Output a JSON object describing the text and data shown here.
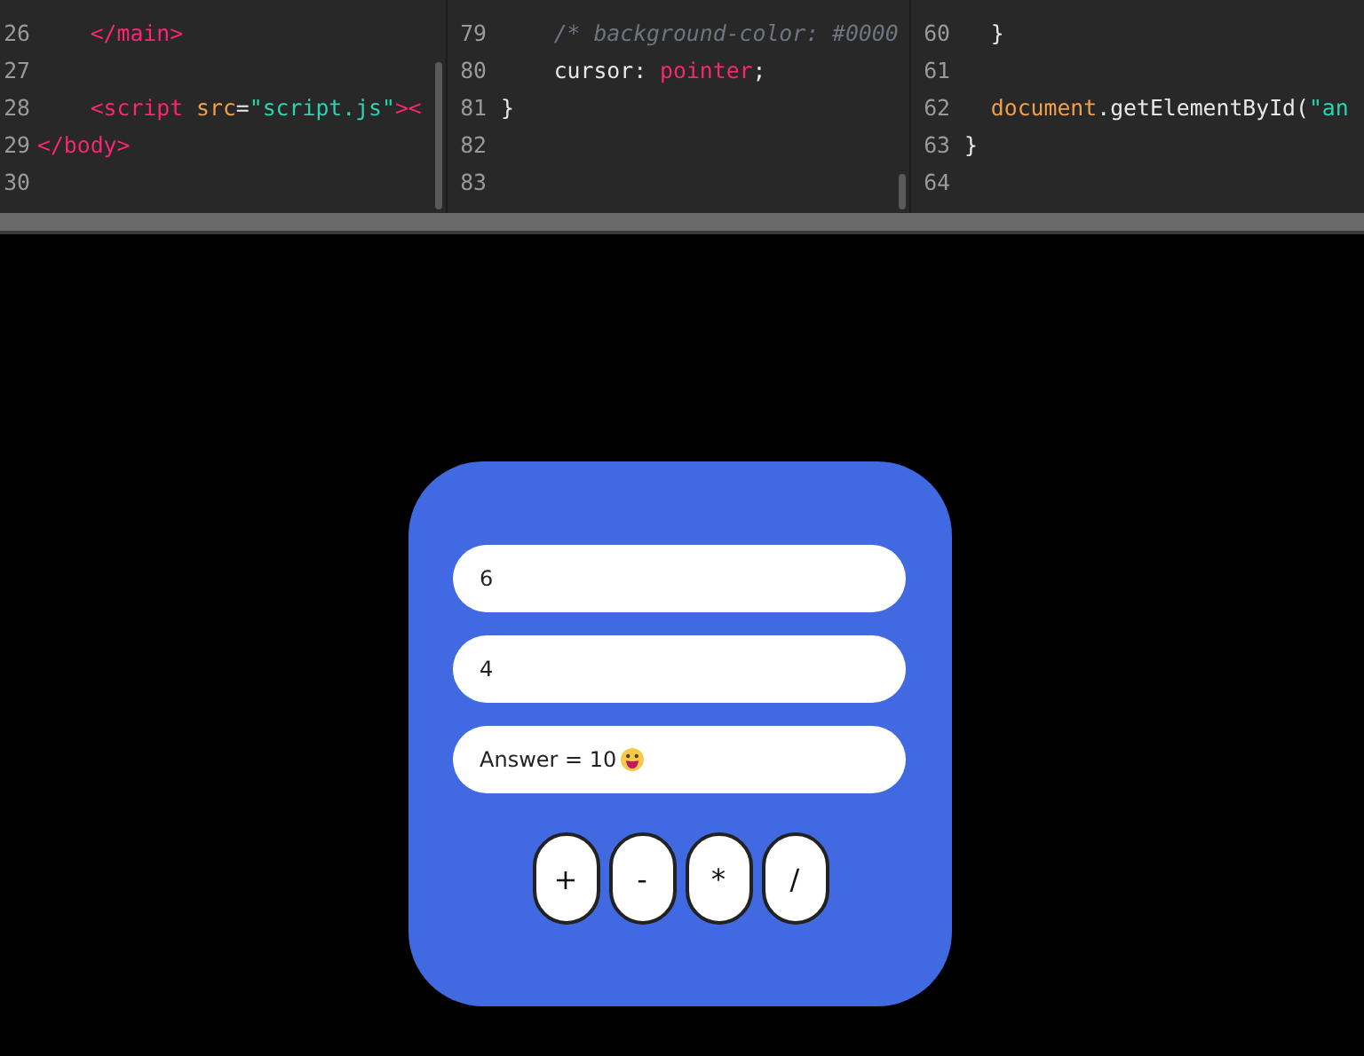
{
  "editor": {
    "panes": [
      {
        "lines": [
          {
            "number": "26",
            "tokens": [
              {
                "text": "    </main>",
                "kind": "tag"
              }
            ]
          },
          {
            "number": "27"
          },
          {
            "number": "28",
            "tokens": [
              {
                "text": "    <script ",
                "kind": "tag"
              },
              {
                "text": "src",
                "kind": "attr"
              },
              {
                "text": "=",
                "kind": "plain"
              },
              {
                "text": "\"script.js\"",
                "kind": "string"
              },
              {
                "text": "><",
                "kind": "tag"
              }
            ]
          },
          {
            "number": "29",
            "tokens": [
              {
                "text": "</body>",
                "kind": "tag"
              }
            ]
          },
          {
            "number": "30"
          }
        ]
      },
      {
        "lines": [
          {
            "number": "79",
            "tokens": [
              {
                "text": "    /* background-color: #0000",
                "kind": "comment"
              }
            ]
          },
          {
            "number": "80",
            "tokens": [
              {
                "text": "    cursor: ",
                "kind": "plain"
              },
              {
                "text": "pointer",
                "kind": "tag"
              },
              {
                "text": ";",
                "kind": "plain"
              }
            ]
          },
          {
            "number": "81",
            "tokens": [
              {
                "text": "}",
                "kind": "plain"
              }
            ]
          },
          {
            "number": "82"
          },
          {
            "number": "83"
          }
        ]
      },
      {
        "lines": [
          {
            "number": "60",
            "tokens": [
              {
                "text": "  }",
                "kind": "plain"
              }
            ]
          },
          {
            "number": "61"
          },
          {
            "number": "62",
            "tokens": [
              {
                "text": "  document",
                "kind": "attr"
              },
              {
                "text": ".getElementById(",
                "kind": "plain"
              },
              {
                "text": "\"an",
                "kind": "string"
              }
            ]
          },
          {
            "number": "63",
            "tokens": [
              {
                "text": "}",
                "kind": "plain"
              }
            ]
          },
          {
            "number": "64"
          }
        ]
      }
    ]
  },
  "calculator": {
    "first_number": "6",
    "second_number": "4",
    "answer": "Answer = 10",
    "operators": [
      "+",
      "-",
      "*",
      "/"
    ]
  }
}
